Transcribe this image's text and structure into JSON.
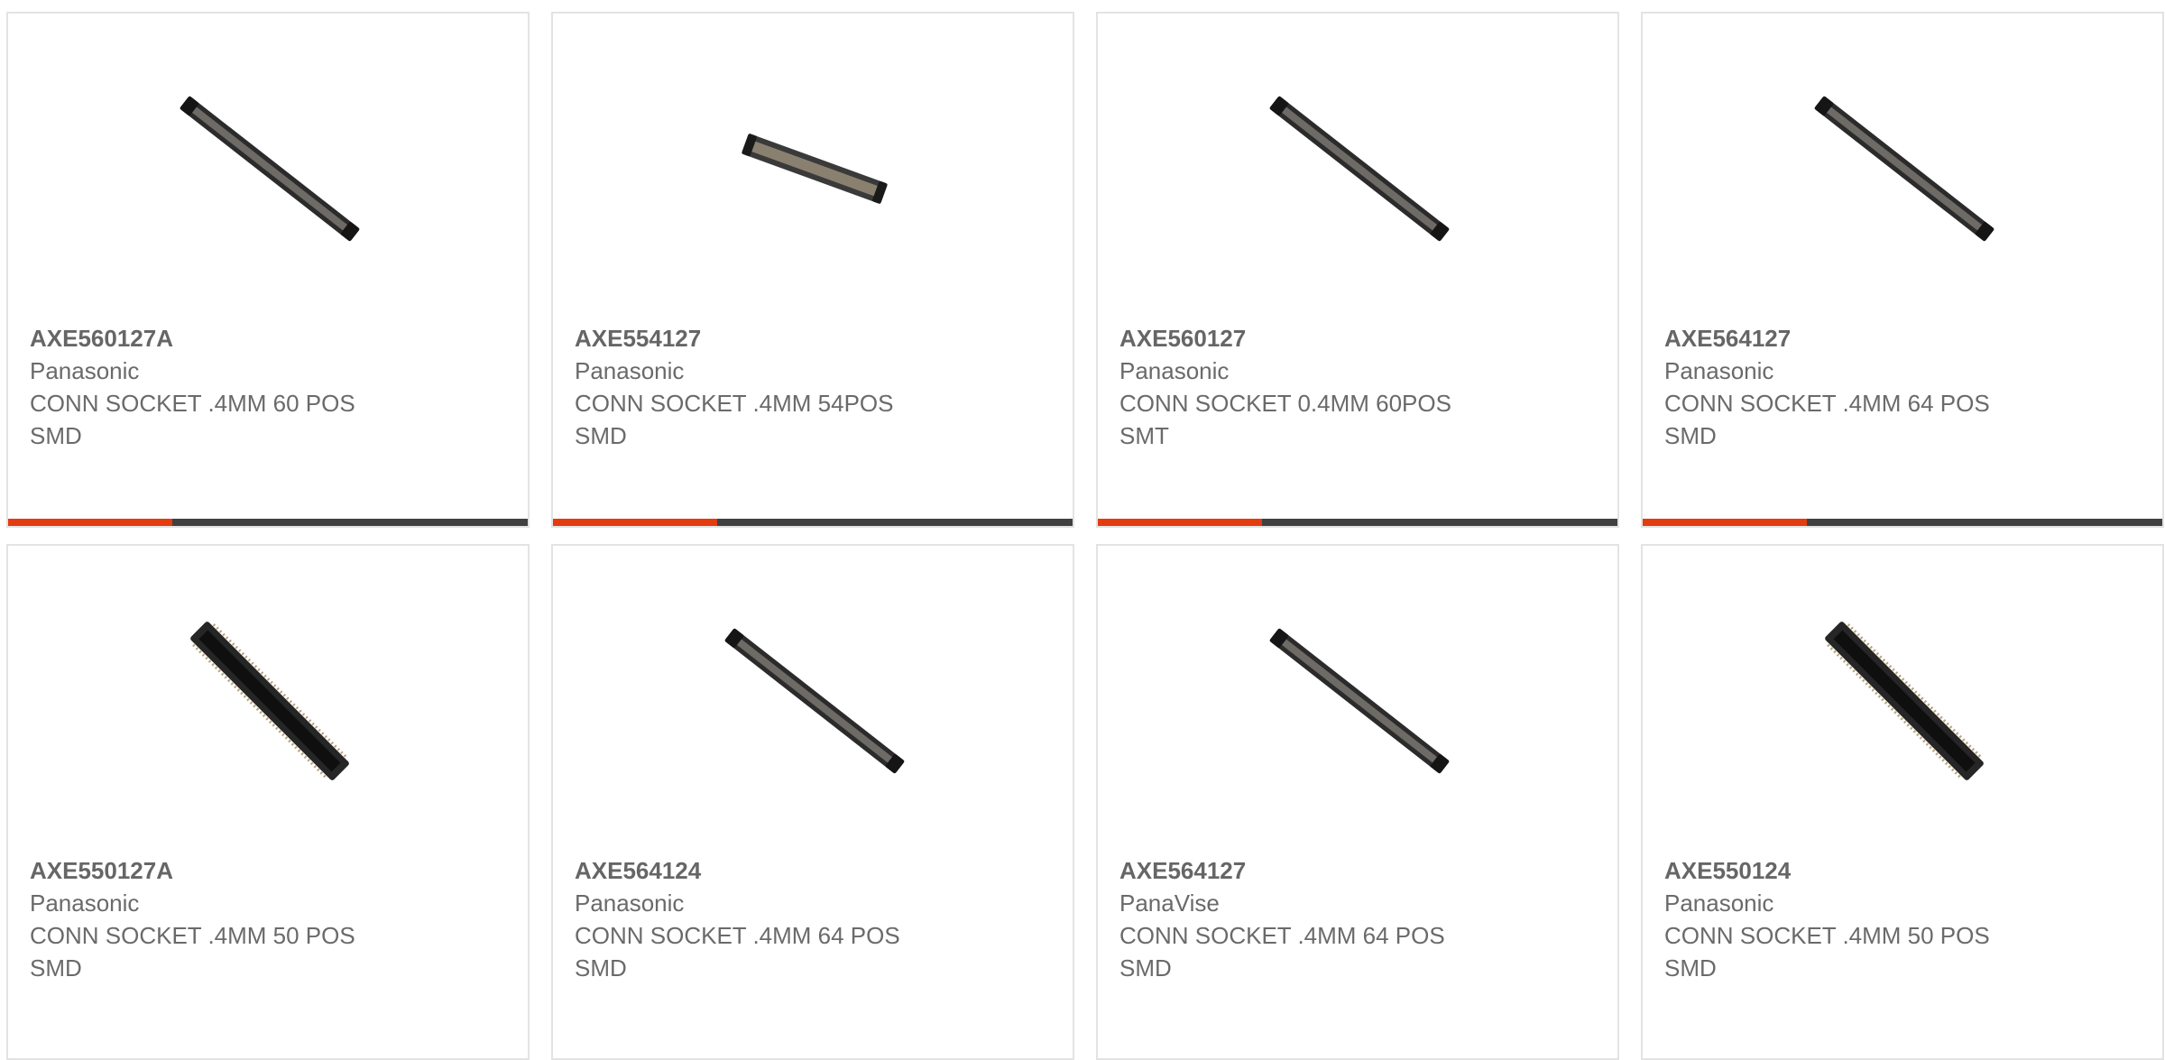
{
  "colors": {
    "accent": "#e33c0e",
    "bar_dark": "#414141",
    "text": "#6a6a6a",
    "border": "#e3e3e3"
  },
  "products": [
    {
      "part_number": "AXE560127A",
      "manufacturer": "Panasonic",
      "desc_line1": "CONN SOCKET .4MM 60 POS",
      "desc_line2": "SMD",
      "image": "connector-diagonal-long-icon"
    },
    {
      "part_number": "AXE554127",
      "manufacturer": "Panasonic",
      "desc_line1": "CONN SOCKET .4MM 54POS",
      "desc_line2": "SMD",
      "image": "connector-shallow-icon"
    },
    {
      "part_number": "AXE560127",
      "manufacturer": "Panasonic",
      "desc_line1": "CONN SOCKET 0.4MM 60POS",
      "desc_line2": "SMT",
      "image": "connector-diagonal-long-icon"
    },
    {
      "part_number": "AXE564127",
      "manufacturer": "Panasonic",
      "desc_line1": "CONN SOCKET .4MM 64 POS",
      "desc_line2": "SMD",
      "image": "connector-diagonal-long-icon"
    },
    {
      "part_number": "AXE550127A",
      "manufacturer": "Panasonic",
      "desc_line1": "CONN SOCKET .4MM 50 POS",
      "desc_line2": "SMD",
      "image": "connector-diagonal-wide-icon"
    },
    {
      "part_number": "AXE564124",
      "manufacturer": "Panasonic",
      "desc_line1": "CONN SOCKET .4MM 64 POS",
      "desc_line2": "SMD",
      "image": "connector-diagonal-long-icon"
    },
    {
      "part_number": "AXE564127",
      "manufacturer": "PanaVise",
      "desc_line1": "CONN SOCKET .4MM 64 POS",
      "desc_line2": "SMD",
      "image": "connector-diagonal-long-icon"
    },
    {
      "part_number": "AXE550124",
      "manufacturer": "Panasonic",
      "desc_line1": "CONN SOCKET .4MM 50 POS",
      "desc_line2": "SMD",
      "image": "connector-diagonal-wide-icon"
    }
  ]
}
